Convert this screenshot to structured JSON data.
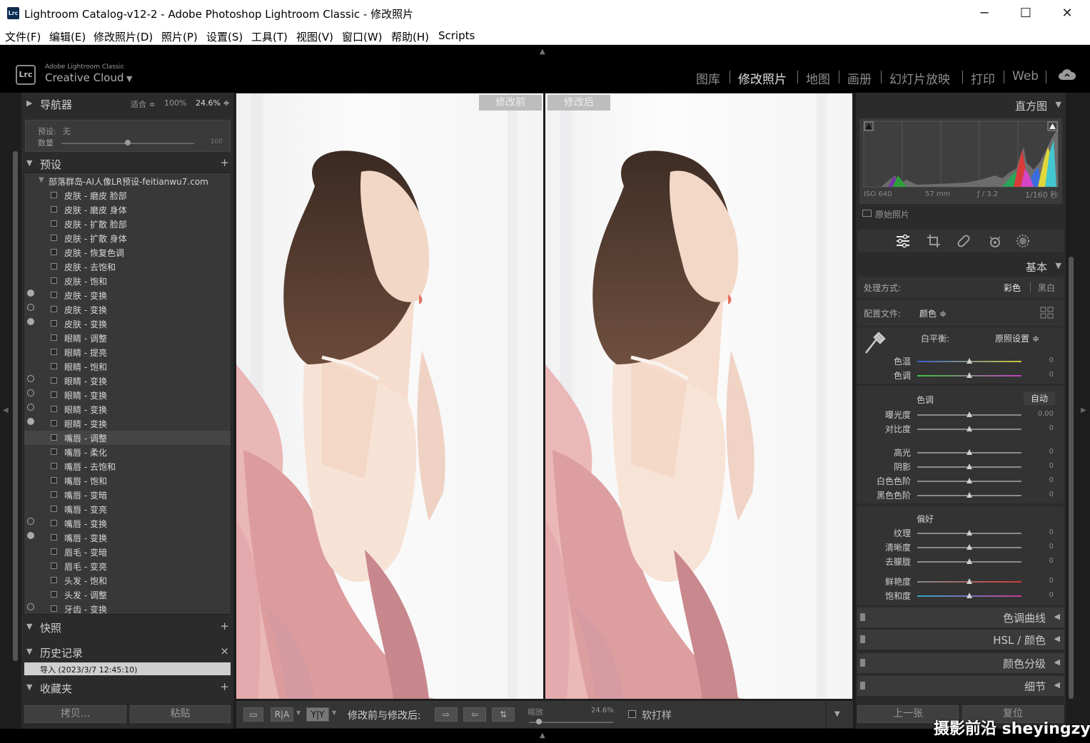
{
  "window": {
    "title": "Lightroom Catalog-v12-2 - Adobe Photoshop Lightroom Classic - 修改照片",
    "app_icon_text": "Lrc",
    "controls": {
      "minimize": "─",
      "maximize": "☐",
      "close": "✕"
    }
  },
  "menu": [
    "文件(F)",
    "编辑(E)",
    "修改照片(D)",
    "照片(P)",
    "设置(S)",
    "工具(T)",
    "视图(V)",
    "窗口(W)",
    "帮助(H)",
    "Scripts"
  ],
  "brand": {
    "logo": "Lrc",
    "small": "Adobe Lightroom Classic",
    "big": "Creative Cloud",
    "caret": "▼"
  },
  "modules": [
    {
      "label": "图库",
      "active": false
    },
    {
      "label": "修改照片",
      "active": true
    },
    {
      "label": "地图",
      "active": false
    },
    {
      "label": "画册",
      "active": false
    },
    {
      "label": "幻灯片放映",
      "active": false
    },
    {
      "label": "打印",
      "active": false
    },
    {
      "label": "Web",
      "active": false
    }
  ],
  "navigator": {
    "title": "导航器",
    "fit": "适合 ≑",
    "zoom_100": "100%",
    "zoom_current": "24.6% ≑",
    "preset_label": "预设:",
    "preset_value": "无",
    "amount_label": "数量",
    "amount_max": "100",
    "amount_fraction": 0.5
  },
  "presets": {
    "title": "预设",
    "add": "+",
    "group": "部落群岛-AI人像LR预设-feitianwu7.com",
    "items": [
      {
        "label": "皮肤 - 磨皮 脸部",
        "dot": "",
        "selected": false
      },
      {
        "label": "皮肤 - 磨皮 身体",
        "dot": "",
        "selected": false
      },
      {
        "label": "皮肤 - 扩散 脸部",
        "dot": "",
        "selected": false
      },
      {
        "label": "皮肤 - 扩散 身体",
        "dot": "",
        "selected": false
      },
      {
        "label": "皮肤 - 恢复色调",
        "dot": "",
        "selected": false
      },
      {
        "label": "皮肤 - 去饱和",
        "dot": "",
        "selected": false
      },
      {
        "label": "皮肤 - 饱和",
        "dot": "",
        "selected": false
      },
      {
        "label": "皮肤 - 变换",
        "dot": "filled",
        "selected": false
      },
      {
        "label": "皮肤 - 变换",
        "dot": "outline",
        "selected": false
      },
      {
        "label": "皮肤 - 变换",
        "dot": "filled",
        "selected": false
      },
      {
        "label": "眼睛 - 调整",
        "dot": "",
        "selected": false
      },
      {
        "label": "眼睛 - 提亮",
        "dot": "",
        "selected": false
      },
      {
        "label": "眼睛 - 饱和",
        "dot": "",
        "selected": false
      },
      {
        "label": "眼睛 - 变换",
        "dot": "outline",
        "selected": false
      },
      {
        "label": "眼睛 - 变换",
        "dot": "outline",
        "selected": false
      },
      {
        "label": "眼睛 - 变换",
        "dot": "outline",
        "selected": false
      },
      {
        "label": "眼睛 - 变换",
        "dot": "filled",
        "selected": false
      },
      {
        "label": "嘴唇 - 调整",
        "dot": "",
        "selected": true
      },
      {
        "label": "嘴唇 - 柔化",
        "dot": "",
        "selected": false
      },
      {
        "label": "嘴唇 - 去饱和",
        "dot": "",
        "selected": false
      },
      {
        "label": "嘴唇 - 饱和",
        "dot": "",
        "selected": false
      },
      {
        "label": "嘴唇 - 变暗",
        "dot": "",
        "selected": false
      },
      {
        "label": "嘴唇 - 变亮",
        "dot": "",
        "selected": false
      },
      {
        "label": "嘴唇 - 变换",
        "dot": "outline",
        "selected": false
      },
      {
        "label": "嘴唇 - 变换",
        "dot": "filled",
        "selected": false
      },
      {
        "label": "眉毛 - 变暗",
        "dot": "",
        "selected": false
      },
      {
        "label": "眉毛 - 变亮",
        "dot": "",
        "selected": false
      },
      {
        "label": "头发 - 饱和",
        "dot": "",
        "selected": false
      },
      {
        "label": "头发 - 调整",
        "dot": "",
        "selected": false
      },
      {
        "label": "牙齿 - 变换",
        "dot": "outline",
        "selected": false
      }
    ]
  },
  "snapshots": {
    "title": "快照",
    "add": "+"
  },
  "history": {
    "title": "历史记录",
    "clear": "×",
    "entry": "导入 (2023/3/7 12:45:10)"
  },
  "collections": {
    "title": "收藏夹",
    "add": "+"
  },
  "left_buttons": {
    "copy": "拷贝...",
    "paste": "粘贴"
  },
  "compare": {
    "before": "修改前",
    "after": "修改后"
  },
  "toolbar": {
    "view_loupe": "▭",
    "view_ra": "R|A",
    "view_yy": "Y|Y",
    "label": "修改前与修改后:",
    "swap1": "⇨",
    "swap2": "⇦",
    "swap3": "⇅",
    "zoom_label": "缩放",
    "zoom_value": "24.6%",
    "zoom_fraction": 0.12,
    "softproof": "软打样",
    "menu_caret": "▼"
  },
  "histogram": {
    "title": "直方图",
    "iso": "ISO 640",
    "focal": "57 mm",
    "aperture": "ƒ / 3.2",
    "shutter": "1/160 秒",
    "original": "原始照片"
  },
  "basic": {
    "title": "基本",
    "treatment_label": "处理方式:",
    "color": "彩色",
    "bw": "黑白",
    "profile_label": "配置文件:",
    "profile_value": "颜色 ≑",
    "wb_label": "白平衡:",
    "wb_value": "原照设置 ≑",
    "tone_label": "色调",
    "auto": "自动",
    "presence_label": "偏好",
    "sliders": [
      {
        "label": "色温",
        "value": "0",
        "pos": 0.5,
        "group": "wb"
      },
      {
        "label": "色调",
        "value": "0",
        "pos": 0.5,
        "group": "wb"
      },
      {
        "label": "曝光度",
        "value": "0.00",
        "pos": 0.5,
        "group": "tone"
      },
      {
        "label": "对比度",
        "value": "0",
        "pos": 0.5,
        "group": "tone"
      },
      {
        "label": "高光",
        "value": "0",
        "pos": 0.5,
        "group": "tone2"
      },
      {
        "label": "阴影",
        "value": "0",
        "pos": 0.5,
        "group": "tone2"
      },
      {
        "label": "白色色阶",
        "value": "0",
        "pos": 0.5,
        "group": "tone2"
      },
      {
        "label": "黑色色阶",
        "value": "0",
        "pos": 0.5,
        "group": "tone2"
      },
      {
        "label": "纹理",
        "value": "0",
        "pos": 0.5,
        "group": "presence"
      },
      {
        "label": "清晰度",
        "value": "0",
        "pos": 0.5,
        "group": "presence"
      },
      {
        "label": "去朦胧",
        "value": "0",
        "pos": 0.5,
        "group": "presence"
      },
      {
        "label": "鲜艳度",
        "value": "0",
        "pos": 0.5,
        "group": "presence2"
      },
      {
        "label": "饱和度",
        "value": "0",
        "pos": 0.5,
        "group": "presence2"
      }
    ]
  },
  "collapsed_panels": [
    "色调曲线",
    "HSL / 颜色",
    "颜色分级",
    "细节"
  ],
  "right_buttons": {
    "prev": "上一张",
    "reset": "复位"
  },
  "watermark": "摄影前沿 sheyingzyz.com",
  "colors": {
    "accent": "#2b2b2b",
    "active_module": "#e0e0e0",
    "inactive_module": "#8e8e8e"
  }
}
